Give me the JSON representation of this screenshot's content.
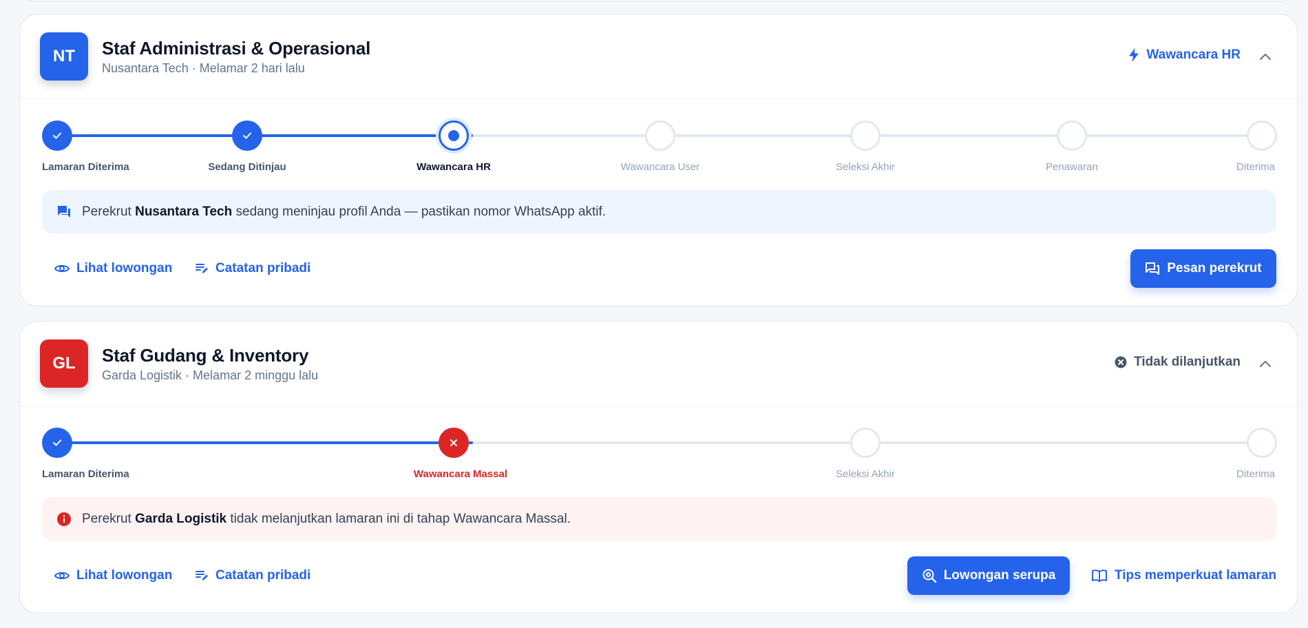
{
  "applications": [
    {
      "logo_initials": "NT",
      "logo_color": "#2563eb",
      "title": "Staf Administrasi & Operasional",
      "subtitle": "Nusantara Tech · Melamar 2 hari lalu",
      "status_label": "Wawancara HR",
      "status_color": "#2563eb",
      "steps": [
        {
          "label": "Lamaran Diterima",
          "state": "done"
        },
        {
          "label": "Sedang Ditinjau",
          "state": "done"
        },
        {
          "label": "Wawancara HR",
          "state": "current"
        },
        {
          "label": "Wawancara User",
          "state": "todo"
        },
        {
          "label": "Seleksi Akhir",
          "state": "todo"
        },
        {
          "label": "Penawaran",
          "state": "todo"
        },
        {
          "label": "Diterima",
          "state": "todo"
        }
      ],
      "notice": {
        "prefix": "Perekrut ",
        "company": "Nusantara Tech",
        "suffix": " sedang meninjau profil Anda — pastikan nomor WhatsApp aktif."
      },
      "actions": {
        "view_job": "Lihat lowongan",
        "notes": "Catatan pribadi",
        "message_recruiter": "Pesan perekrut"
      }
    },
    {
      "logo_initials": "GL",
      "logo_color": "#dc2626",
      "title": "Staf Gudang & Inventory",
      "subtitle": "Garda Logistik · Melamar 2 minggu lalu",
      "status_label": "Tidak dilanjutkan",
      "status_color": "#475569",
      "steps": [
        {
          "label": "Lamaran Diterima",
          "state": "done"
        },
        {
          "label": "Wawancara Massal",
          "state": "fail"
        },
        {
          "label": "Seleksi Akhir",
          "state": "todo"
        },
        {
          "label": "Diterima",
          "state": "todo"
        }
      ],
      "notice": {
        "prefix": "Perekrut ",
        "company": "Garda Logistik",
        "suffix": " tidak melanjutkan lamaran ini di tahap Wawancara Massal."
      },
      "actions": {
        "view_job": "Lihat lowongan",
        "notes": "Catatan pribadi",
        "similar_jobs": "Lowongan serupa",
        "tips": "Tips memperkuat lamaran"
      }
    }
  ]
}
